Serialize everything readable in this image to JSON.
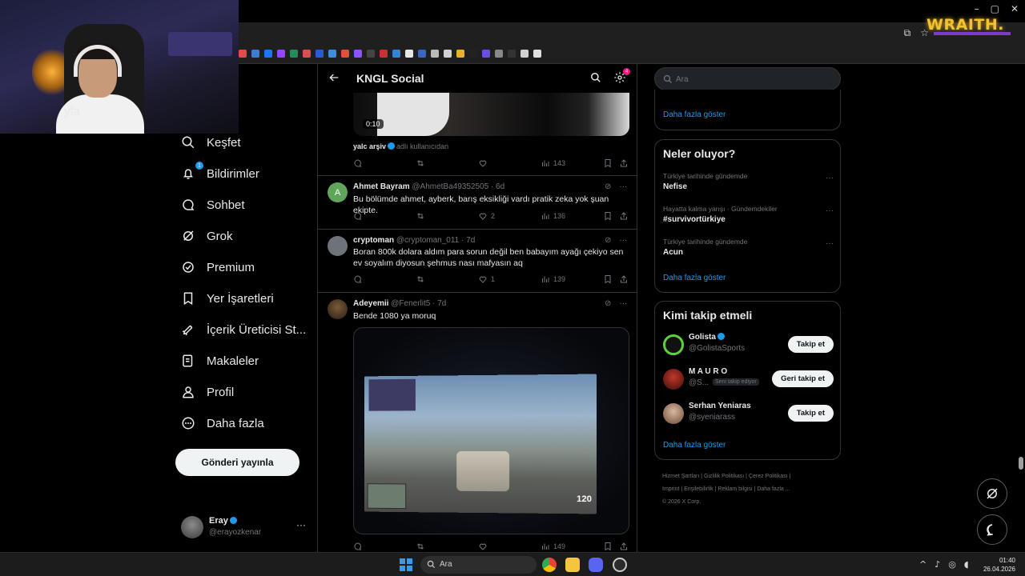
{
  "overlay": {
    "brand": "WRAITH."
  },
  "nav": {
    "partial_home": "yfa",
    "items": [
      {
        "label": "Keşfet",
        "icon": "search-icon"
      },
      {
        "label": "Bildirimler",
        "icon": "bell-icon",
        "badge": "1"
      },
      {
        "label": "Sohbet",
        "icon": "chat-icon"
      },
      {
        "label": "Grok",
        "icon": "grok-icon"
      },
      {
        "label": "Premium",
        "icon": "premium-icon"
      },
      {
        "label": "Yer İşaretleri",
        "icon": "bookmark-icon"
      },
      {
        "label": "İçerik Üreticisi St...",
        "icon": "rocket-icon"
      },
      {
        "label": "Makaleler",
        "icon": "article-icon"
      },
      {
        "label": "Profil",
        "icon": "person-icon"
      },
      {
        "label": "Daha fazla",
        "icon": "more-circle-icon"
      }
    ],
    "post_button": "Gönderi yayınla",
    "account": {
      "name": "Eray",
      "handle": "@erayozkenar",
      "more": "···"
    }
  },
  "timeline": {
    "title": "KNGL Social",
    "settings_badge": "4",
    "first_post": {
      "duration": "0:10",
      "attrib_name": "yalc arşiv",
      "attrib_suffix": "adlı kullanıcıdan",
      "views": "143"
    },
    "posts": [
      {
        "name": "Ahmet Bayram",
        "meta": "@AhmetBa49352505 · 6d",
        "avatar_letter": "A",
        "text": "Bu bölümde ahmet, ayberk, barış eksikliği vardı pratik zeka yok şuan ekipte.",
        "likes": "2",
        "views": "136"
      },
      {
        "name": "cryptoman",
        "meta": "@cryptoman_011 · 7d",
        "text": "Boran 800k dolara aldım para sorun değil ben babayım ayağı çekiyo sen ev soyalım diyosun şehmus nası mafyasın aq",
        "likes": "1",
        "views": "139"
      },
      {
        "name": "Adeyemii",
        "meta": "@Fenerlit5 · 7d",
        "text": "Bende 1080 ya moruq",
        "hud_value": "120",
        "views": "149"
      }
    ]
  },
  "sidebar": {
    "search_placeholder": "Ara",
    "top_card_show_more": "Daha fazla göster",
    "trends_title": "Neler oluyor?",
    "trends": [
      {
        "context": "Türkiye tarihinde gündemde",
        "name": "Nefise"
      },
      {
        "context": "Hayatta kalma yarışı · Gündemdekiler",
        "name": "#survivortürkiye"
      },
      {
        "context": "Türkiye tarihinde gündemde",
        "name": "Acun"
      }
    ],
    "trends_show_more": "Daha fazla göster",
    "who_title": "Kimi takip etmeli",
    "who": [
      {
        "name": "Golista",
        "handle": "@GolistaSports",
        "button": "Takip et",
        "verified": true
      },
      {
        "name": "M A U R O",
        "handle": "@S...",
        "tag": "Seni takip ediyor",
        "button": "Geri takip et",
        "verified": false
      },
      {
        "name": "Serhan Yeniaras",
        "handle": "@syeniarass",
        "button": "Takip et",
        "verified": false
      }
    ],
    "who_show_more": "Daha fazla göster",
    "footer": [
      "Hizmet Şartları",
      "Gizlilik Politikası",
      "Çerez Politikası",
      "Imprint",
      "Erişilebilirlik",
      "Reklam bilgisi",
      "Daha fazla ...",
      "© 2026 X Corp."
    ]
  },
  "taskbar": {
    "search_label": "Ara",
    "time": "01:40",
    "date": "26.04.2026"
  }
}
